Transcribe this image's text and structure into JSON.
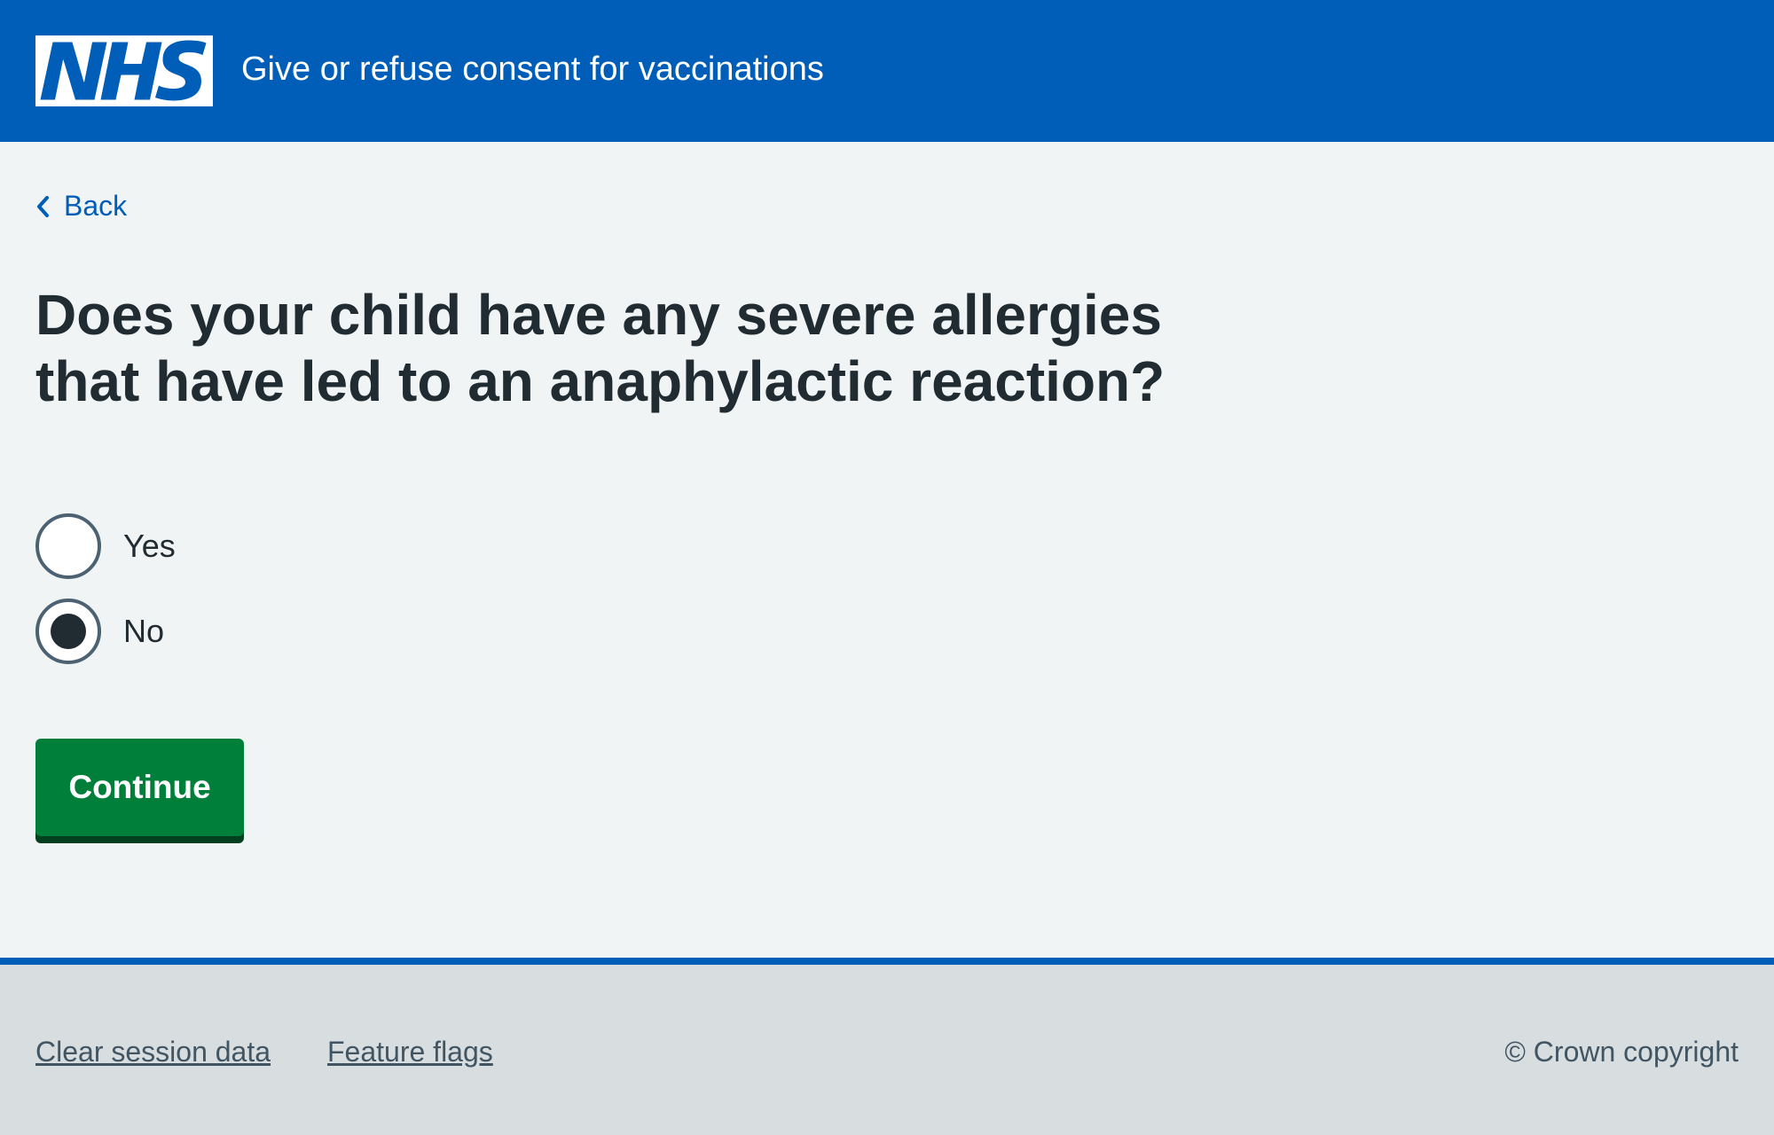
{
  "header": {
    "logo_text": "NHS",
    "logo_icon": "nhs-logo-icon",
    "service_name": "Give or refuse consent for vaccinations",
    "background_color": "#005eb8"
  },
  "navigation": {
    "back_label": "Back",
    "back_icon": "chevron-left-icon"
  },
  "form": {
    "question": "Does your child have any severe allergies that have led to an anaphylactic reaction?",
    "options": [
      {
        "label": "Yes",
        "selected": false
      },
      {
        "label": "No",
        "selected": true
      }
    ],
    "submit_label": "Continue",
    "submit_color": "#007f3b"
  },
  "footer": {
    "links": [
      {
        "label": "Clear session data"
      },
      {
        "label": "Feature flags"
      }
    ],
    "copyright": "© Crown copyright",
    "border_color": "#005eb8"
  }
}
